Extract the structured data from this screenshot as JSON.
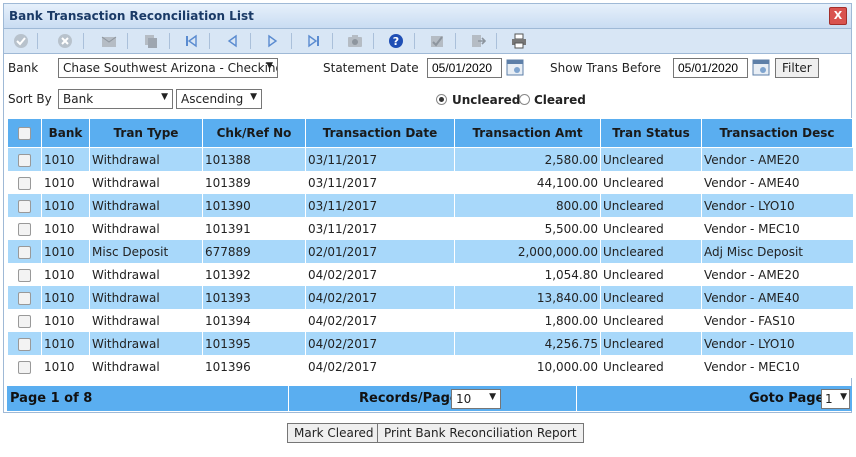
{
  "window": {
    "title": "Bank Transaction Reconciliation List",
    "close_label": "X"
  },
  "toolbar": {
    "icons": [
      "check-icon",
      "cancel-icon",
      "mail-icon",
      "copy-icon",
      "first-page-icon",
      "prev-page-icon",
      "next-page-icon",
      "last-page-icon",
      "camera-icon",
      "help-icon",
      "approve-icon",
      "export-icon",
      "print-icon"
    ]
  },
  "filters": {
    "bank_label": "Bank",
    "bank_value": "Chase Southwest Arizona - Checking",
    "statement_date_label": "Statement Date",
    "statement_date_value": "05/01/2020",
    "show_before_label": "Show Trans Before",
    "show_before_value": "05/01/2020",
    "filter_button": "Filter",
    "sort_by_label": "Sort By",
    "sort_by_value": "Bank",
    "sort_order_value": "Ascending",
    "radio_uncleared": "Uncleared",
    "radio_cleared": "Cleared",
    "selected_radio": "Uncleared"
  },
  "table": {
    "headers": [
      "Bank",
      "Tran Type",
      "Chk/Ref No",
      "Transaction Date",
      "Transaction Amt",
      "Tran Status",
      "Transaction Desc"
    ],
    "rows": [
      {
        "bank": "1010",
        "type": "Withdrawal",
        "ref": "101388",
        "date": "03/11/2017",
        "amt": "2,580.00",
        "status": "Uncleared",
        "desc": "Vendor - AME20"
      },
      {
        "bank": "1010",
        "type": "Withdrawal",
        "ref": "101389",
        "date": "03/11/2017",
        "amt": "44,100.00",
        "status": "Uncleared",
        "desc": "Vendor - AME40"
      },
      {
        "bank": "1010",
        "type": "Withdrawal",
        "ref": "101390",
        "date": "03/11/2017",
        "amt": "800.00",
        "status": "Uncleared",
        "desc": "Vendor - LYO10"
      },
      {
        "bank": "1010",
        "type": "Withdrawal",
        "ref": "101391",
        "date": "03/11/2017",
        "amt": "5,500.00",
        "status": "Uncleared",
        "desc": "Vendor - MEC10"
      },
      {
        "bank": "1010",
        "type": "Misc Deposit",
        "ref": "677889",
        "date": "02/01/2017",
        "amt": "2,000,000.00",
        "status": "Uncleared",
        "desc": "Adj Misc Deposit"
      },
      {
        "bank": "1010",
        "type": "Withdrawal",
        "ref": "101392",
        "date": "04/02/2017",
        "amt": "1,054.80",
        "status": "Uncleared",
        "desc": "Vendor - AME20"
      },
      {
        "bank": "1010",
        "type": "Withdrawal",
        "ref": "101393",
        "date": "04/02/2017",
        "amt": "13,840.00",
        "status": "Uncleared",
        "desc": "Vendor - AME40"
      },
      {
        "bank": "1010",
        "type": "Withdrawal",
        "ref": "101394",
        "date": "04/02/2017",
        "amt": "1,800.00",
        "status": "Uncleared",
        "desc": "Vendor - FAS10"
      },
      {
        "bank": "1010",
        "type": "Withdrawal",
        "ref": "101395",
        "date": "04/02/2017",
        "amt": "4,256.75",
        "status": "Uncleared",
        "desc": "Vendor - LYO10"
      },
      {
        "bank": "1010",
        "type": "Withdrawal",
        "ref": "101396",
        "date": "04/02/2017",
        "amt": "10,000.00",
        "status": "Uncleared",
        "desc": "Vendor - MEC10"
      }
    ]
  },
  "pager": {
    "page_info": "Page 1 of 8",
    "records_label": "Records/Page",
    "records_value": "10",
    "goto_label": "Goto Page",
    "goto_value": "1"
  },
  "actions": {
    "mark_cleared": "Mark Cleared",
    "print_report": "Print Bank Reconciliation Report"
  },
  "colors": {
    "header_blue": "#5aaef0",
    "row_blue": "#a8d8fa",
    "toolbar": "#d8e6f5"
  }
}
